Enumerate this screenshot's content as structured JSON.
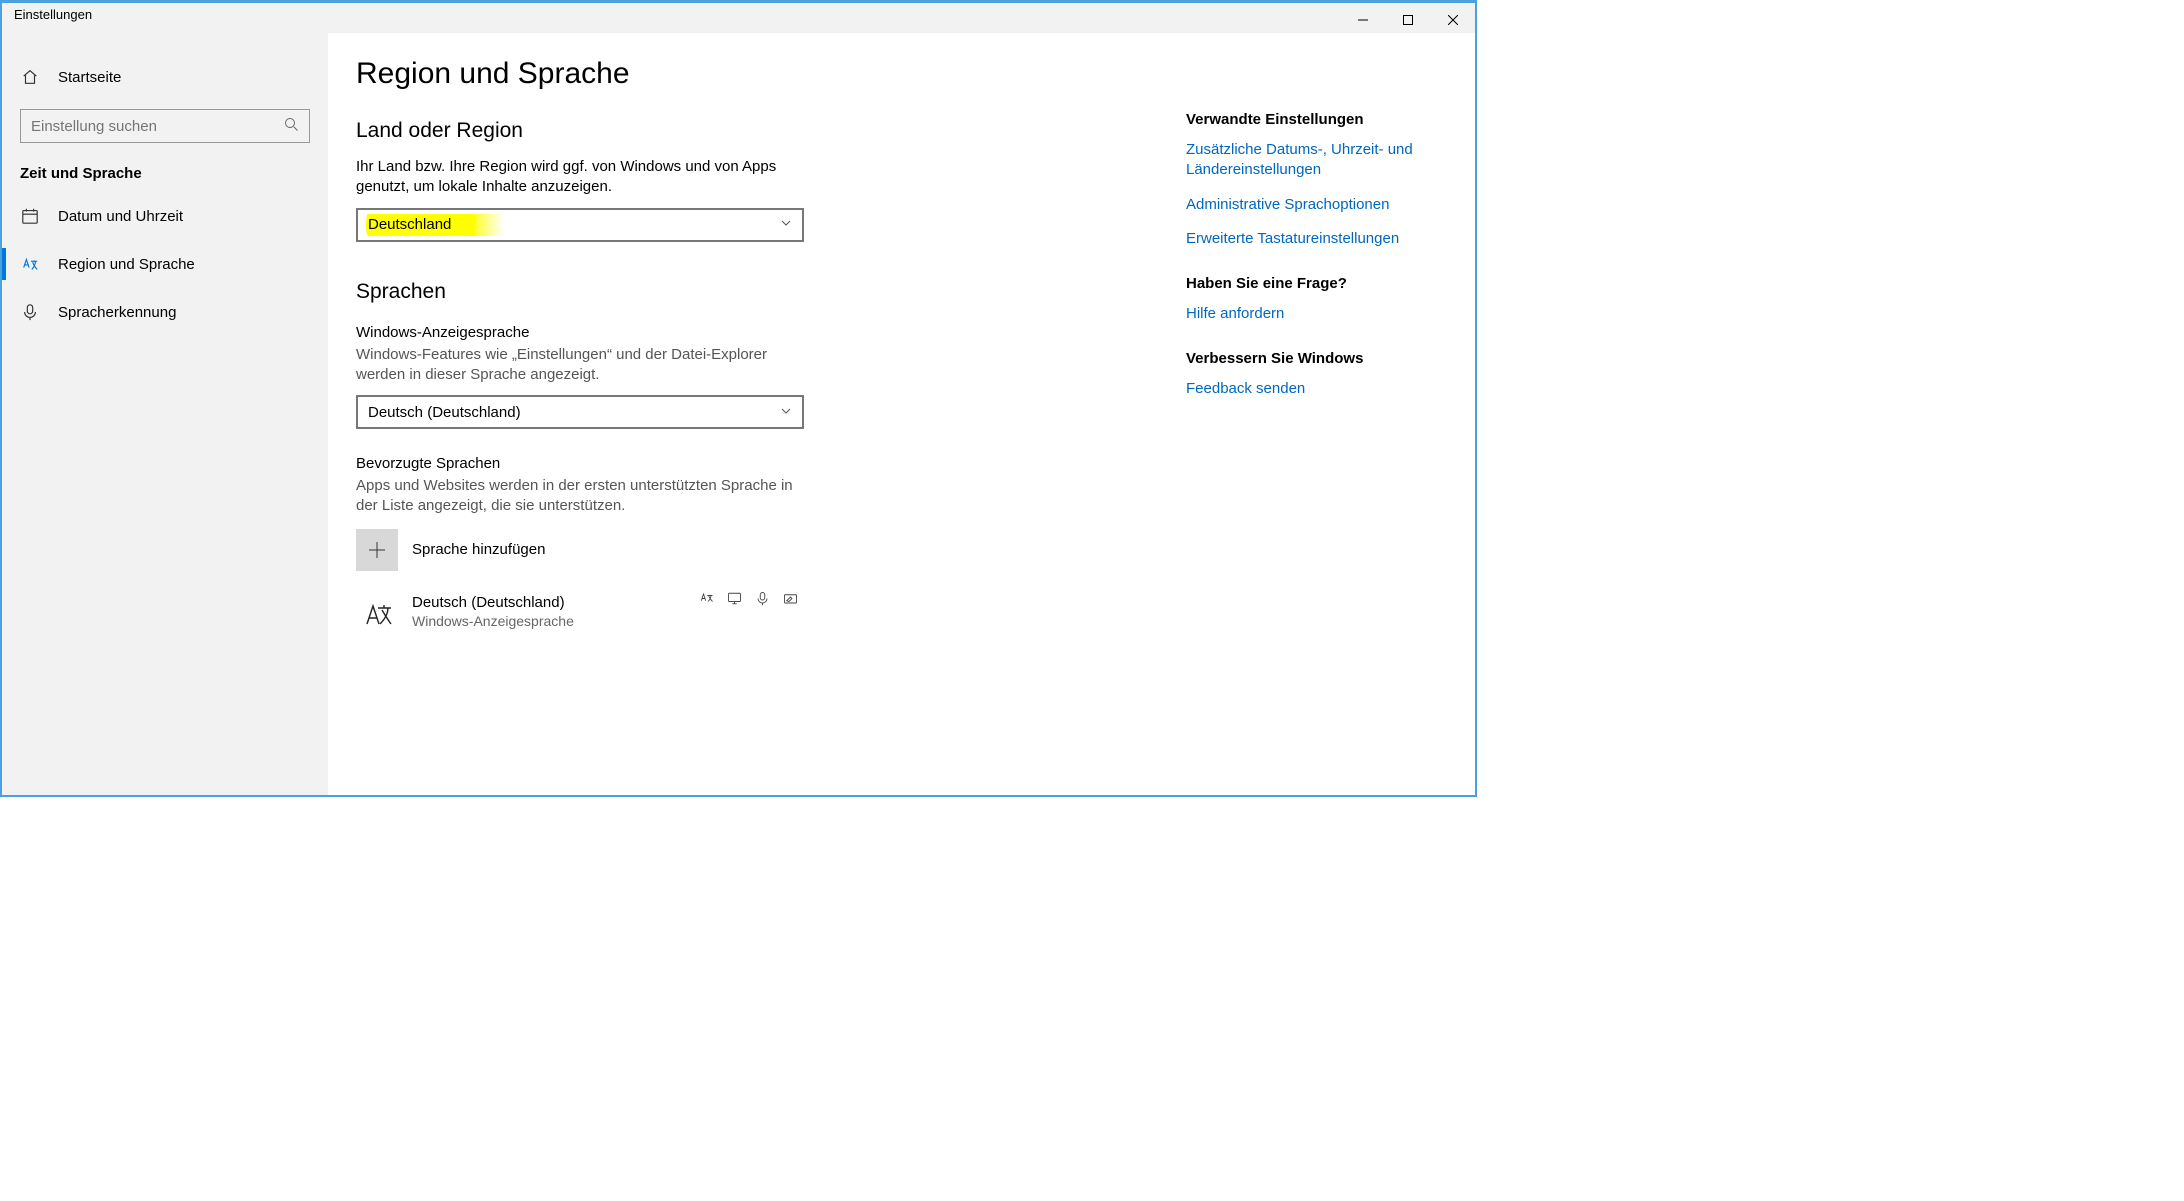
{
  "window": {
    "title": "Einstellungen"
  },
  "sidebar": {
    "home": "Startseite",
    "search_placeholder": "Einstellung suchen",
    "category": "Zeit und Sprache",
    "items": [
      {
        "label": "Datum und Uhrzeit"
      },
      {
        "label": "Region und Sprache"
      },
      {
        "label": "Spracherkennung"
      }
    ]
  },
  "page": {
    "title": "Region und Sprache",
    "region": {
      "heading": "Land oder Region",
      "desc": "Ihr Land bzw. Ihre Region wird ggf. von Windows und von Apps genutzt, um lokale Inhalte anzuzeigen.",
      "value": "Deutschland"
    },
    "languages": {
      "heading": "Sprachen",
      "display_label": "Windows-Anzeigesprache",
      "display_desc": "Windows-Features wie „Einstellungen“ und der Datei-Explorer werden in dieser Sprache angezeigt.",
      "display_value": "Deutsch (Deutschland)",
      "preferred_label": "Bevorzugte Sprachen",
      "preferred_desc": "Apps und Websites werden in der ersten unterstützten Sprache in der Liste angezeigt, die sie unterstützen.",
      "add_label": "Sprache hinzufügen",
      "installed": {
        "name": "Deutsch (Deutschland)",
        "sub": "Windows-Anzeigesprache"
      }
    }
  },
  "right": {
    "related_heading": "Verwandte Einstellungen",
    "link1": "Zusätzliche Datums-, Uhrzeit- und Ländereinstellungen",
    "link2": "Administrative Sprachoptionen",
    "link3": "Erweiterte Tastatureinstellungen",
    "help_heading": "Haben Sie eine Frage?",
    "help_link": "Hilfe anfordern",
    "improve_heading": "Verbessern Sie Windows",
    "improve_link": "Feedback senden"
  }
}
